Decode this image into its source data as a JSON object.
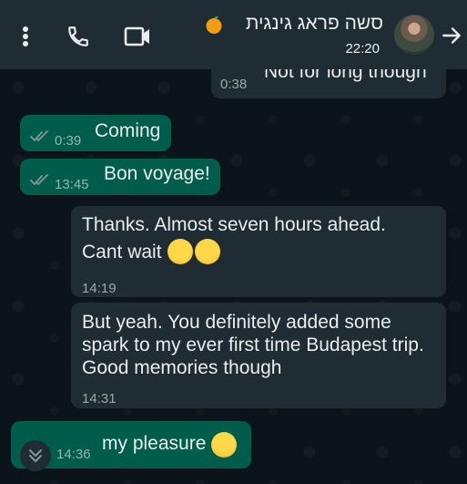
{
  "header": {
    "contact_name": "סשה פראג גינגית",
    "last_seen": "22:20",
    "icons": {
      "menu": "more-vertical-icon",
      "call": "phone-icon",
      "video": "video-call-icon",
      "back": "arrow-right-icon",
      "emoji": "orange-emoji-icon"
    }
  },
  "messages": [
    {
      "direction": "in",
      "text": "Not for long though",
      "time": "0:38"
    },
    {
      "direction": "out",
      "text": "Coming",
      "time": "0:39",
      "status": "read"
    },
    {
      "direction": "out",
      "text": "Bon voyage!",
      "time": "13:45",
      "status": "read"
    },
    {
      "direction": "in",
      "line1": "Thanks. Almost seven hours ahead.",
      "line2": "Cant wait",
      "emoji": "😄😄",
      "time": "14:19"
    },
    {
      "direction": "in",
      "line1": "But yeah. You definitely added some",
      "line2": "spark to my ever first time Budapest trip.",
      "line3": "Good memories though",
      "time": "14:31"
    },
    {
      "direction": "out",
      "text": "my pleasure",
      "emoji": "😌",
      "time": "14:36"
    }
  ],
  "colors": {
    "header_bg": "#1f2c34",
    "chat_bg": "#0b141a",
    "incoming_bubble": "#202c33",
    "outgoing_bubble": "#005c4b",
    "read_ticks": "#8696a0"
  }
}
